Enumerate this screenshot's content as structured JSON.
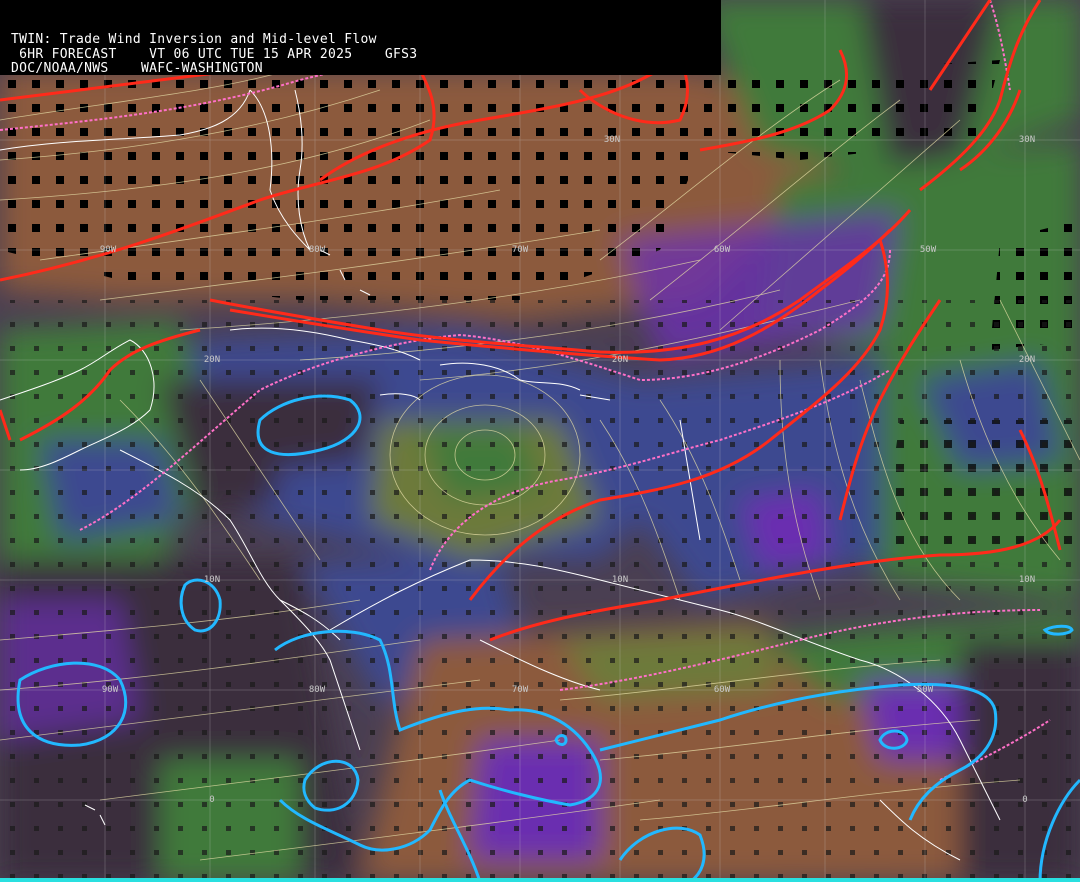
{
  "header": {
    "line1": "TWIN: Trade Wind Inversion and Mid-level Flow",
    "line2": " 6HR FORECAST    VT 06 UTC TUE 15 APR 2025    GFS3",
    "line3": "DOC/NOAA/NWS    WAFC-WASHINGTON"
  },
  "grid_labels": {
    "lat_30n": "30N",
    "lat_30n_e": "30N",
    "lat_20n_w": "20N",
    "lat_20n_c": "20N",
    "lat_20n_e": "20N",
    "lat_10n_w": "10N",
    "lat_10n_c": "10N",
    "lat_10n_e": "10N",
    "lat_0_w": "0",
    "lat_0_e": "0",
    "lon_90w_n": "90W",
    "lon_80w_n": "80W",
    "lon_70w_n": "70W",
    "lon_60w_n": "60W",
    "lon_50w_n": "50W",
    "lon_90w_s": "90W",
    "lon_80w_s": "80W",
    "lon_70w_s": "70W",
    "lon_60w_s": "60W",
    "lon_50w_s": "50W"
  },
  "colors": {
    "brown": "#8a5a3a",
    "tan": "#a5884a",
    "green": "#3f7a3a",
    "olive": "#6d7a3a",
    "blue": "#3d4890",
    "purple": "#6a2fb0",
    "dark": "#3a2f3c",
    "contour_red": "#ff2a1a",
    "contour_pink": "#ff70c8",
    "contour_cyan": "#22b8ff",
    "coast": "#ffffff",
    "streamline": "#e8e0a8",
    "gridline": "#d0d0d0"
  }
}
